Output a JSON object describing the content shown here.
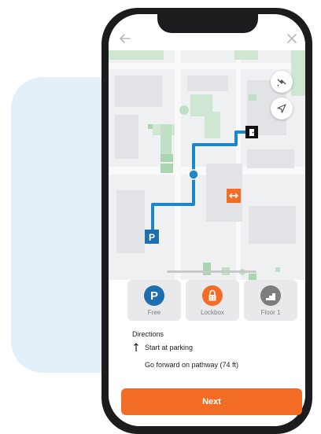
{
  "colors": {
    "accent_orange": "#f26c26",
    "route_blue": "#1f86c8",
    "parking_blue": "#1f6fb0",
    "background_blob": "#e3f0fa",
    "tile_bg": "#e9e9ec"
  },
  "header": {
    "back_icon": "arrow-left-icon",
    "close_icon": "close-icon"
  },
  "map": {
    "controls": [
      {
        "name": "satellite-icon"
      },
      {
        "name": "location-arrow-icon"
      }
    ],
    "markers": {
      "parking_label": "P",
      "entrance_icon": "door-icon",
      "lockbox_marker_icon": "lockbox-marker-icon"
    }
  },
  "tiles": [
    {
      "label": "Free",
      "icon": "parking-icon",
      "glyph": "P",
      "color": "#1f6fb0"
    },
    {
      "label": "Lockbox",
      "icon": "lockbox-icon",
      "color": "#f26c26"
    },
    {
      "label": "Floor 1",
      "icon": "stairs-icon",
      "color": "#7d7d80"
    }
  ],
  "directions": {
    "title": "Directions",
    "steps": [
      {
        "text": "Start at parking",
        "icon": "up-down-arrow-icon"
      },
      {
        "text": "Go forward on pathway (74 ft)"
      }
    ]
  },
  "next_button": {
    "label": "Next"
  }
}
